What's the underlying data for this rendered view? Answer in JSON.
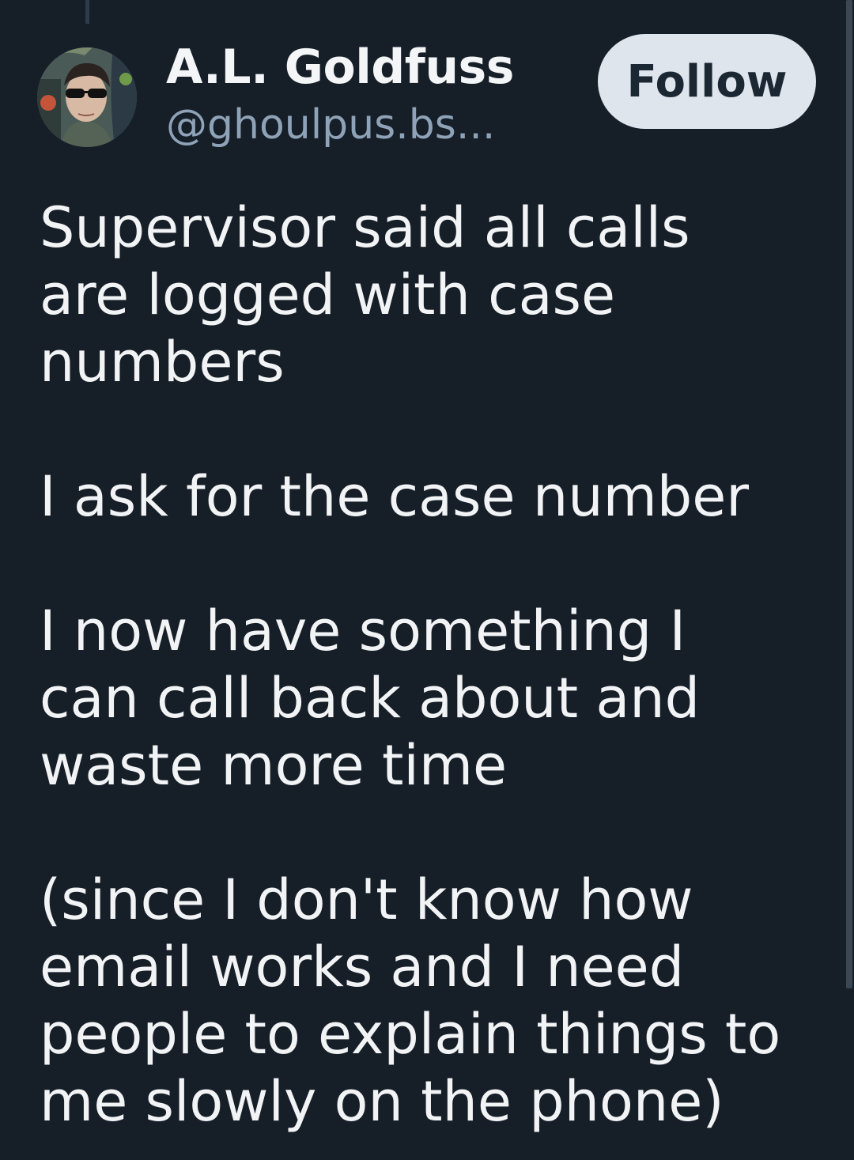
{
  "author": {
    "display_name": "A.L. Goldfuss",
    "handle": "@ghoulpus.bs...",
    "avatar_icon": "user-avatar-photo"
  },
  "follow_button": {
    "label": "Follow"
  },
  "post": {
    "lines": [
      "Supervisor said all calls",
      "are logged with case",
      "numbers",
      "",
      "I ask for the case number",
      "",
      "I now have something I",
      "can call back about and",
      "waste more time",
      "",
      "(since I don't know how",
      "email works and I need",
      "people to explain things to",
      "me slowly on the phone)"
    ]
  },
  "colors": {
    "background": "#161e27",
    "text": "#f1f3f5",
    "handle": "#8fa3b8",
    "follow_bg": "#dfe5ec",
    "follow_text": "#1b2733"
  }
}
